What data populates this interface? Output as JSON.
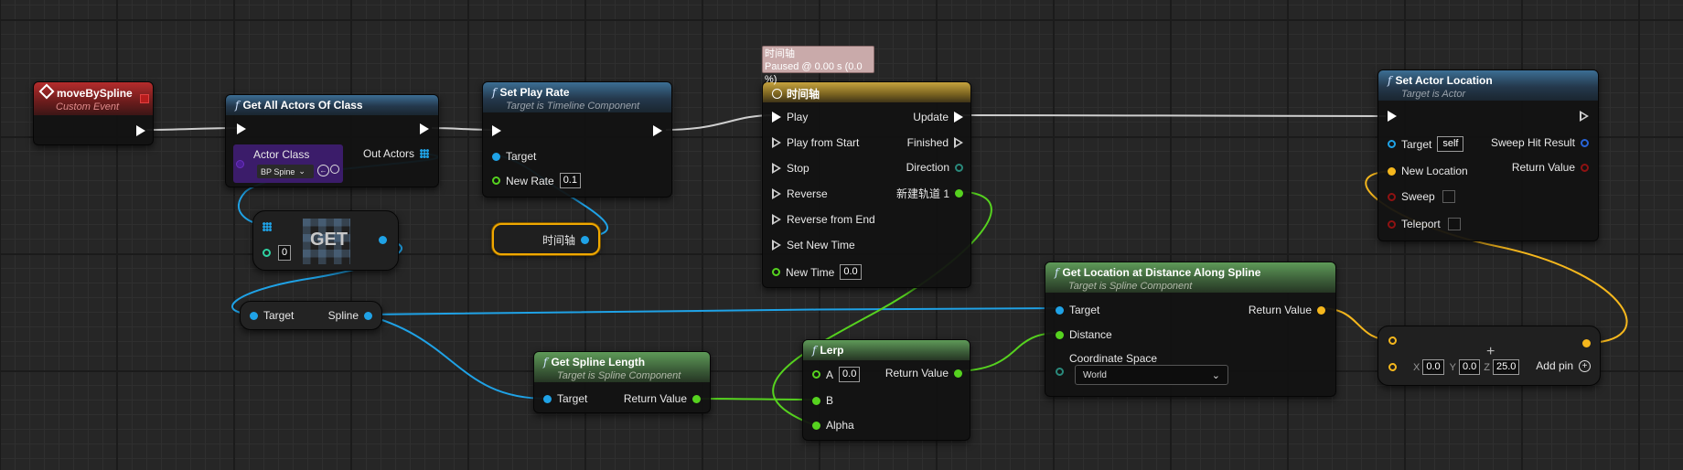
{
  "colors": {
    "exec": "#ffffff",
    "object": "#1fa2e6",
    "int": "#2fd2a2",
    "float": "#56d21f",
    "vector": "#f5b71d",
    "struct_blue": "#2864d8",
    "bool": "#8f1212",
    "class": "#6b2fc0"
  },
  "tooltip": {
    "line1": "时间轴",
    "line2": "Paused @ 0.00 s (0.0 %)"
  },
  "event_node": {
    "title": "moveBySpline",
    "subtitle": "Custom Event"
  },
  "get_all_actors": {
    "title": "Get All Actors Of Class",
    "actor_class_label": "Actor Class",
    "actor_class_value": "BP Spine",
    "out_actors_label": "Out Actors"
  },
  "get_node": {
    "label": "GET",
    "index": "0"
  },
  "target_spline": {
    "target_label": "Target",
    "spline_label": "Spline"
  },
  "set_play_rate": {
    "title": "Set Play Rate",
    "subtitle": "Target is Timeline Component",
    "target_label": "Target",
    "new_rate_label": "New Rate",
    "new_rate_value": "0.1"
  },
  "timeline_var": {
    "label": "时间轴"
  },
  "get_spline_length": {
    "title": "Get Spline Length",
    "subtitle": "Target is Spline Component",
    "target_label": "Target",
    "return_label": "Return Value"
  },
  "timeline_node": {
    "title": "时间轴",
    "inputs": [
      "Play",
      "Play from Start",
      "Stop",
      "Reverse",
      "Reverse from End",
      "Set New Time"
    ],
    "new_time_label": "New Time",
    "new_time_value": "0.0",
    "outputs": [
      "Update",
      "Finished",
      "Direction",
      "新建轨道 1"
    ]
  },
  "lerp_node": {
    "title": "Lerp",
    "a_label": "A",
    "a_value": "0.0",
    "b_label": "B",
    "alpha_label": "Alpha",
    "return_label": "Return Value"
  },
  "get_location": {
    "title": "Get Location at Distance Along Spline",
    "subtitle": "Target is Spline Component",
    "target_label": "Target",
    "distance_label": "Distance",
    "coord_label": "Coordinate Space",
    "coord_value": "World",
    "return_label": "Return Value"
  },
  "set_actor_location": {
    "title": "Set Actor Location",
    "subtitle": "Target is Actor",
    "target_label": "Target",
    "target_value": "self",
    "new_location_label": "New Location",
    "sweep_label": "Sweep",
    "teleport_label": "Teleport",
    "sweep_hit_label": "Sweep Hit Result",
    "return_label": "Return Value"
  },
  "add_node": {
    "x_label": "X",
    "x_value": "0.0",
    "y_label": "Y",
    "y_value": "0.0",
    "z_label": "Z",
    "z_value": "25.0",
    "add_pin_label": "Add pin"
  }
}
